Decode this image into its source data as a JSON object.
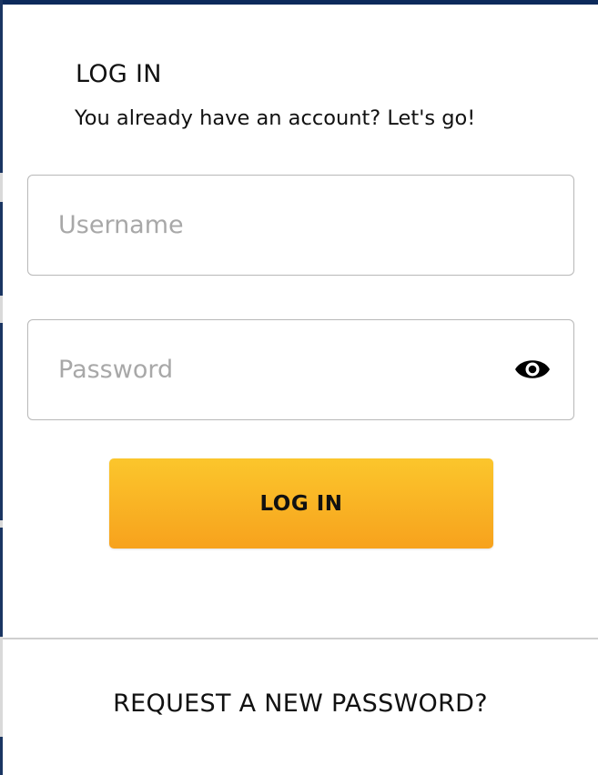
{
  "login": {
    "title": "LOG IN",
    "subtitle": "You already have an account? Let's go!",
    "username": {
      "placeholder": "Username",
      "value": ""
    },
    "password": {
      "placeholder": "Password",
      "value": "",
      "toggle_icon": "eye-icon"
    },
    "submit_label": "LOG IN",
    "request_password_label": "REQUEST A NEW PASSWORD?"
  },
  "colors": {
    "button_gradient_top": "#fbc62c",
    "button_gradient_bottom": "#f7a21d",
    "background_strip": "#0c2a5b"
  }
}
